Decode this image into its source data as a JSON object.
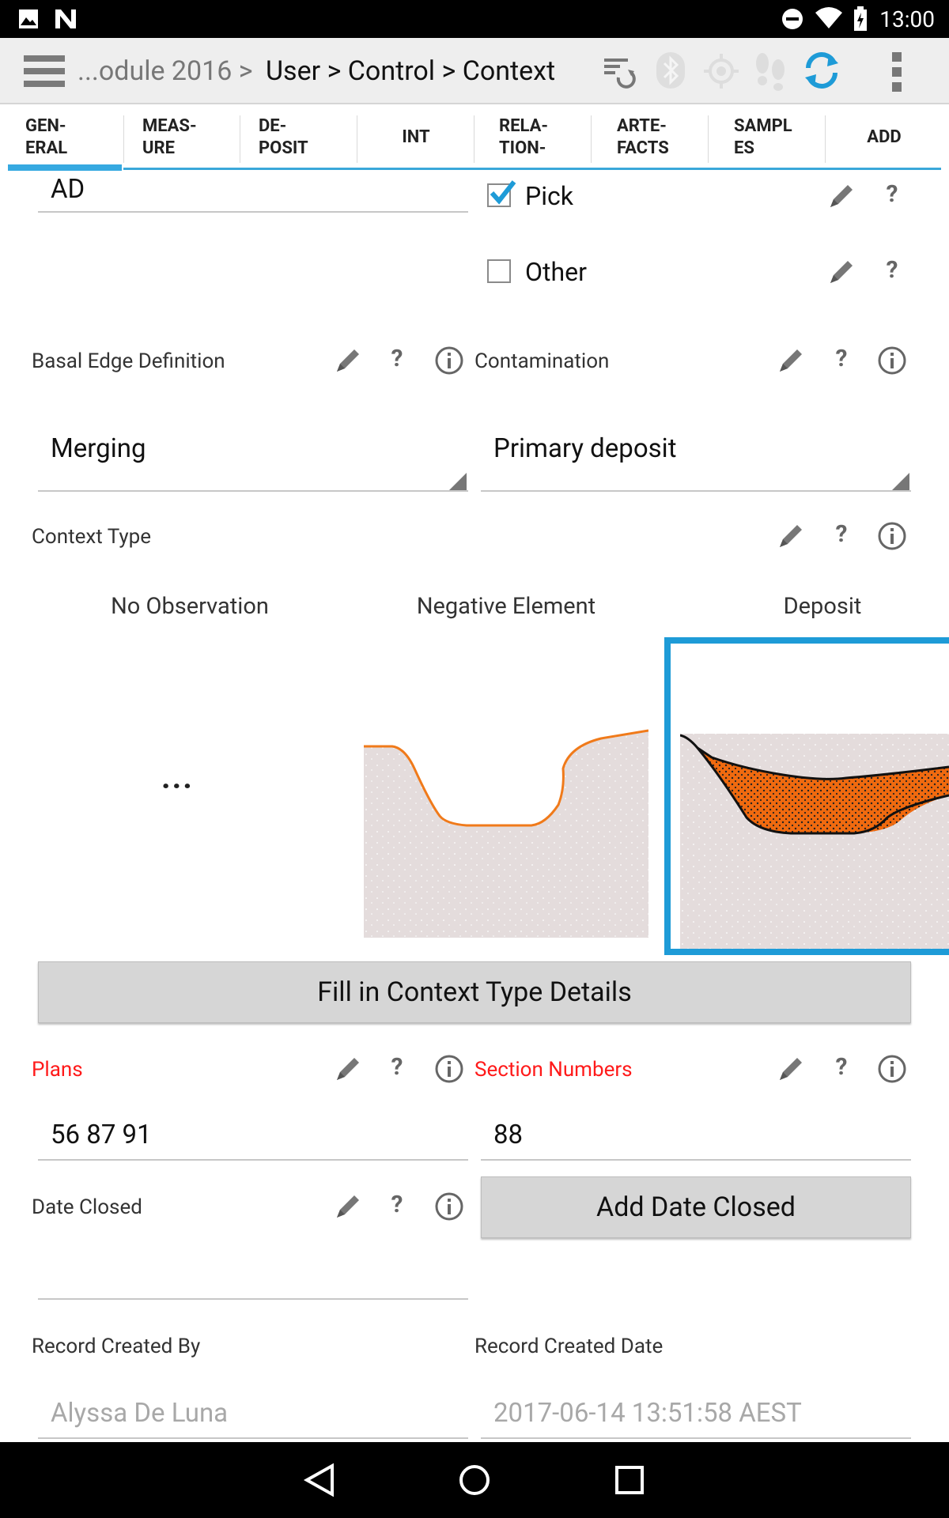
{
  "status_bar": {
    "time": "13:00"
  },
  "action_bar": {
    "breadcrumb_prefix": "...odule 2016 >",
    "breadcrumb_path": "User > Control > Context"
  },
  "tabs": [
    {
      "label": "GEN-\nERAL",
      "l1": "GEN-",
      "l2": "ERAL",
      "active": true
    },
    {
      "label": "MEAS-\nURE",
      "l1": "MEAS-",
      "l2": "URE"
    },
    {
      "label": "DE-\nPOSIT",
      "l1": "DE-",
      "l2": "POSIT"
    },
    {
      "label": "INT",
      "l1": "INT",
      "l2": ""
    },
    {
      "label": "RELA-\nTION-",
      "l1": "RELA-",
      "l2": "TION-"
    },
    {
      "label": "ARTE-\nFACTS",
      "l1": "ARTE-",
      "l2": "FACTS"
    },
    {
      "label": "SAMPL\nES",
      "l1": "SAMPL",
      "l2": "ES"
    },
    {
      "label": "ADD",
      "l1": "ADD",
      "l2": ""
    }
  ],
  "form": {
    "top_field_value": "AD",
    "pick_label": "Pick",
    "pick_checked": true,
    "other_label": "Other",
    "other_checked": false,
    "basal_edge": {
      "label": "Basal Edge Definition",
      "value": "Merging"
    },
    "contamination": {
      "label": "Contamination",
      "value": "Primary deposit"
    },
    "context_type": {
      "label": "Context Type",
      "options": [
        "No Observation",
        "Negative Element",
        "Deposit"
      ],
      "no_observation_symbol": "...",
      "selected": "Deposit"
    },
    "fill_button": "Fill in Context Type Details",
    "plans": {
      "label": "Plans",
      "value": "56 87 91"
    },
    "section_numbers": {
      "label": "Section Numbers",
      "value": "88"
    },
    "date_closed": {
      "label": "Date Closed",
      "button": "Add Date Closed",
      "value": ""
    },
    "record_created_by": {
      "label": "Record Created By",
      "value": "Alyssa De Luna"
    },
    "record_created_date": {
      "label": "Record Created Date",
      "value": "2017-06-14 13:51:58 AEST"
    }
  },
  "colors": {
    "accent": "#1e9bd7",
    "required_label": "#ff1a1a",
    "deposit_fill": "#f06a0f",
    "ground": "#e4dcdc"
  },
  "help_symbol": "?"
}
